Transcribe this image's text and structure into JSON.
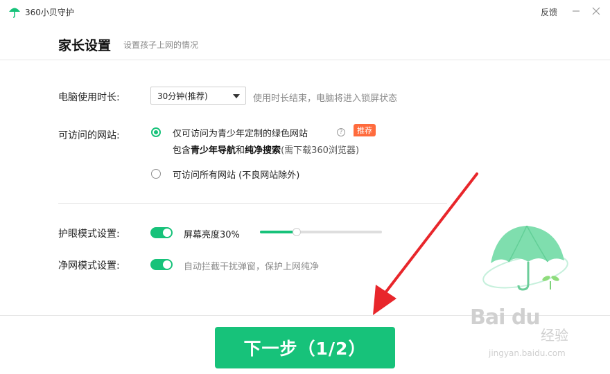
{
  "app": {
    "title": "360小贝守护",
    "feedback": "反馈"
  },
  "header": {
    "title": "家长设置",
    "subtitle": "设置孩子上网的情况"
  },
  "usage": {
    "label": "电脑使用时长:",
    "selected": "30分钟(推荐)",
    "hint": "使用时长结束，电脑将进入锁屏状态"
  },
  "sites": {
    "label": "可访问的网站:",
    "option1": {
      "text": "仅可访问为青少年定制的绿色网站",
      "badge": "推荐",
      "desc_prefix": "包含",
      "desc_bold1": "青少年导航",
      "desc_mid": "和",
      "desc_bold2": "纯净搜索",
      "desc_suffix": "(需下载360浏览器)"
    },
    "option2": {
      "text": "可访问所有网站 (不良网站除外)"
    }
  },
  "eye": {
    "label": "护眼模式设置:",
    "brightness_label": "屏幕亮度30%",
    "brightness": 0.3
  },
  "clean": {
    "label": "净网模式设置:",
    "desc": "自动拦截干扰弹窗，保护上网纯净"
  },
  "footer": {
    "next_label": "下一步（1/2）"
  },
  "watermark": {
    "logo": "Bai du",
    "text": "经验",
    "url": "jingyan.baidu.com"
  },
  "colors": {
    "accent": "#17c27a",
    "badge": "#ff6b3d",
    "arrow": "#e8262b"
  }
}
